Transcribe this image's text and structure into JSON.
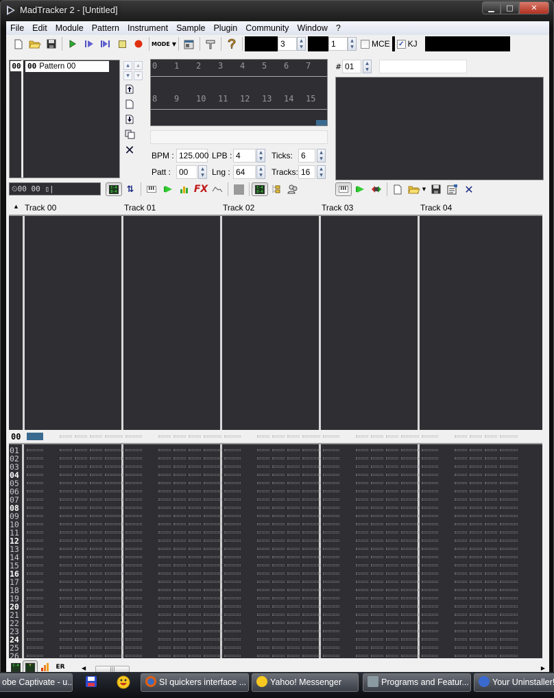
{
  "window": {
    "title": "MadTracker 2 - [Untitled]",
    "controls": {
      "minimize": "▁",
      "maximize": "□",
      "close": "✕"
    }
  },
  "menu": [
    "File",
    "Edit",
    "Module",
    "Pattern",
    "Instrument",
    "Sample",
    "Plugin",
    "Community",
    "Window",
    "?"
  ],
  "toolbar": {
    "icons": [
      "new-icon",
      "open-icon",
      "save-icon",
      "play-icon",
      "play-pattern-icon",
      "play-from-cursor-icon",
      "stop-icon",
      "record-icon",
      "mode-icon",
      "window-icon",
      "settings-icon",
      "help-icon"
    ],
    "mode_label": "MODE",
    "octave_value": "3",
    "step_value": "1",
    "mce_label": "MCE",
    "mce_checked": false,
    "kj_label": "KJ",
    "kj_checked": true
  },
  "order_list": {
    "position": "00",
    "pattern_index": "00",
    "pattern_name": "Pattern 00"
  },
  "tracks_visual": {
    "row1": [
      "0",
      "1",
      "2",
      "3",
      "4",
      "5",
      "6",
      "7"
    ],
    "row2": [
      "8",
      "9",
      "10",
      "11",
      "12",
      "13",
      "14",
      "15"
    ]
  },
  "params": {
    "bpm_label": "BPM :",
    "bpm_value": "125.000",
    "lpb_label": "LPB :",
    "lpb_value": "4",
    "ticks_label": "Ticks:",
    "ticks_value": "6",
    "patt_label": "Patt :",
    "patt_value": "00",
    "lng_label": "Lng :",
    "lng_value": "64",
    "tracks_label": "Tracks:",
    "tracks_value": "16"
  },
  "instrument": {
    "number_label": "#",
    "number_value": "01",
    "name_value": ""
  },
  "time_display": "⏲00 00 ▯|",
  "track_headers": [
    "Track 00",
    "Track 01",
    "Track 02",
    "Track 03",
    "Track 04"
  ],
  "current_row": "00",
  "row_numbers": [
    "01",
    "02",
    "03",
    "04",
    "05",
    "06",
    "07",
    "08",
    "09",
    "10",
    "11",
    "12",
    "13",
    "14",
    "15",
    "16",
    "17",
    "18",
    "19",
    "20",
    "21",
    "22",
    "23",
    "24",
    "25",
    "26"
  ],
  "highlight_every": 4,
  "taskbar": [
    {
      "label": "obe Captivate - u...",
      "icon": "captivate-icon"
    },
    {
      "label": "",
      "icon": "save-disk-icon"
    },
    {
      "label": "",
      "icon": "yahoo-smiley-icon"
    },
    {
      "label": "SI quickers interface ...",
      "icon": "firefox-icon"
    },
    {
      "label": "Yahoo! Messenger",
      "icon": "yahoo-smiley-icon"
    },
    {
      "label": "Programs and Featur...",
      "icon": "programs-icon"
    },
    {
      "label": "Your Uninstaller!",
      "icon": "uninstaller-icon"
    }
  ],
  "colors": {
    "panel_dark": "#2e2e33",
    "selection_blue": "#3a6a90",
    "record_red": "#e03010",
    "play_green": "#20a020"
  }
}
